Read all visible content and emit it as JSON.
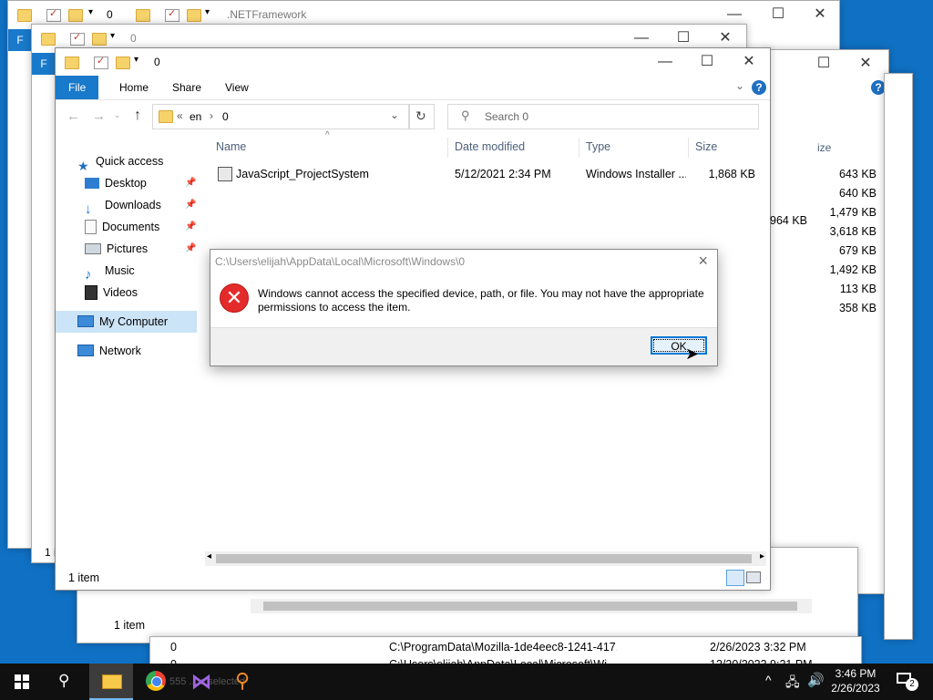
{
  "windows": {
    "back3": {
      "title": ".NETFramework",
      "file_tab": "F"
    },
    "back2": {
      "title": "0",
      "file_tab": "F"
    },
    "back1": {
      "status": "1 i"
    },
    "back_bottom": {
      "status": "1 item"
    }
  },
  "main_window": {
    "title": "0",
    "tabs": [
      "File",
      "Home",
      "Share",
      "View"
    ],
    "address": {
      "chevron": "«",
      "crumbs": [
        "en",
        "0"
      ]
    },
    "search_placeholder": "Search 0",
    "nav": {
      "quick_access": "Quick access",
      "items": [
        {
          "label": "Desktop",
          "pinned": true
        },
        {
          "label": "Downloads",
          "pinned": true
        },
        {
          "label": "Documents",
          "pinned": true
        },
        {
          "label": "Pictures",
          "pinned": true
        },
        {
          "label": "Music",
          "pinned": false
        },
        {
          "label": "Videos",
          "pinned": false
        }
      ],
      "my_computer": "My Computer",
      "network": "Network"
    },
    "columns": {
      "name": "Name",
      "date": "Date modified",
      "type": "Type",
      "size": "Size"
    },
    "files": [
      {
        "name": "JavaScript_ProjectSystem",
        "date": "5/12/2021 2:34 PM",
        "type": "Windows Installer ...",
        "size": "1,868 KB"
      }
    ],
    "status": "1 item"
  },
  "background_sizes": [
    "643 KB",
    "640 KB",
    "1,479 KB",
    "3,618 KB",
    "679 KB",
    "1,492 KB",
    "113 KB",
    "358 KB"
  ],
  "background_size_col": "ize",
  "background_size_mid": "964 KB",
  "background_rows": [
    {
      "name": "0",
      "path": "C:\\ProgramData\\Mozilla-1de4eec8-1241-417...",
      "date": "2/26/2023 3:32 PM"
    },
    {
      "name": "0",
      "path": "C:\\Users\\elijah\\AppData\\Local\\Microsoft\\Wi...",
      "date": "12/30/2023 9:21 PM"
    }
  ],
  "dialog": {
    "title": "C:\\Users\\elijah\\AppData\\Local\\Microsoft\\Windows\\0",
    "message": "Windows cannot access the specified device, path, or file. You may not have the appropriate permissions to access the item.",
    "ok_label": "OK"
  },
  "taskbar": {
    "time": "3:46 PM",
    "date": "2/26/2023",
    "notification_count": "2",
    "hidden_text": "555 ... s selected"
  },
  "colors": {
    "accent": "#1979ca",
    "desktop": "#1071c4",
    "error": "#e42b2b"
  }
}
